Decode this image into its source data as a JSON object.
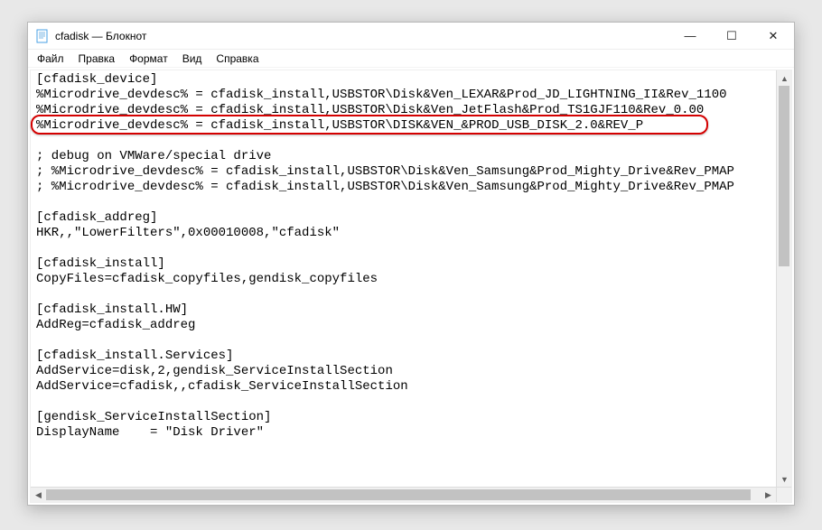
{
  "window": {
    "title": "cfadisk — Блокнот"
  },
  "menu": {
    "file": "Файл",
    "edit": "Правка",
    "format": "Формат",
    "view": "Вид",
    "help": "Справка"
  },
  "content": {
    "l0": "[cfadisk_device]",
    "l1": "%Microdrive_devdesc% = cfadisk_install,USBSTOR\\Disk&Ven_LEXAR&Prod_JD_LIGHTNING_II&Rev_1100",
    "l2": "%Microdrive_devdesc% = cfadisk_install,USBSTOR\\Disk&Ven_JetFlash&Prod_TS1GJF110&Rev_0.00",
    "l3": "%Microdrive_devdesc% = cfadisk_install,USBSTOR\\DISK&VEN_&PROD_USB_DISK_2.0&REV_P",
    "l4": "",
    "l5": "; debug on VMWare/special drive",
    "l6": "; %Microdrive_devdesc% = cfadisk_install,USBSTOR\\Disk&Ven_Samsung&Prod_Mighty_Drive&Rev_PMAP",
    "l7": "; %Microdrive_devdesc% = cfadisk_install,USBSTOR\\Disk&Ven_Samsung&Prod_Mighty_Drive&Rev_PMAP",
    "l8": "",
    "l9": "[cfadisk_addreg]",
    "l10": "HKR,,\"LowerFilters\",0x00010008,\"cfadisk\"",
    "l11": "",
    "l12": "[cfadisk_install]",
    "l13": "CopyFiles=cfadisk_copyfiles,gendisk_copyfiles",
    "l14": "",
    "l15": "[cfadisk_install.HW]",
    "l16": "AddReg=cfadisk_addreg",
    "l17": "",
    "l18": "[cfadisk_install.Services]",
    "l19": "AddService=disk,2,gendisk_ServiceInstallSection",
    "l20": "AddService=cfadisk,,cfadisk_ServiceInstallSection",
    "l21": "",
    "l22": "[gendisk_ServiceInstallSection]",
    "l23": "DisplayName    = \"Disk Driver\""
  },
  "winctrl": {
    "min": "—",
    "max": "☐",
    "close": "✕"
  },
  "scroll": {
    "up": "▲",
    "down": "▼",
    "left": "◀",
    "right": "▶"
  }
}
